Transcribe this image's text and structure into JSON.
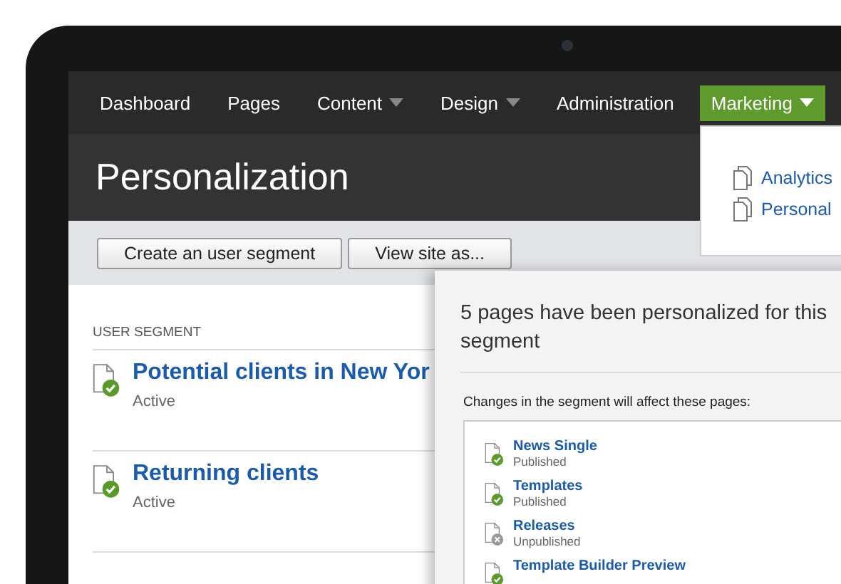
{
  "nav": {
    "items": [
      {
        "label": "Dashboard",
        "selected": false,
        "has_dropdown": false
      },
      {
        "label": "Pages",
        "selected": false,
        "has_dropdown": false
      },
      {
        "label": "Content",
        "selected": false,
        "has_dropdown": true
      },
      {
        "label": "Design",
        "selected": false,
        "has_dropdown": true
      },
      {
        "label": "Administration",
        "selected": false,
        "has_dropdown": false
      },
      {
        "label": "Marketing",
        "selected": true,
        "has_dropdown": true
      }
    ],
    "dropdown": [
      {
        "label": "Analytics"
      },
      {
        "label": "Personal"
      }
    ]
  },
  "page_title": "Personalization",
  "toolbar": {
    "buttons": [
      "Create an user segment",
      "View site as..."
    ]
  },
  "segments": {
    "column": "USER SEGMENT",
    "items": [
      {
        "title": "Potential clients in New Yor",
        "status": "Active",
        "active": true
      },
      {
        "title": "Returning clients",
        "status": "Active",
        "active": true
      }
    ]
  },
  "panel": {
    "title": "5 pages have been personalized for this segment",
    "note": "Changes in the segment will affect these pages:",
    "pages": [
      {
        "title": "News Single",
        "status": "Published",
        "published": true
      },
      {
        "title": "Templates",
        "status": "Published",
        "published": true
      },
      {
        "title": "Releases",
        "status": "Unpublished",
        "published": false
      },
      {
        "title": "Template Builder Preview",
        "published": true
      }
    ]
  }
}
